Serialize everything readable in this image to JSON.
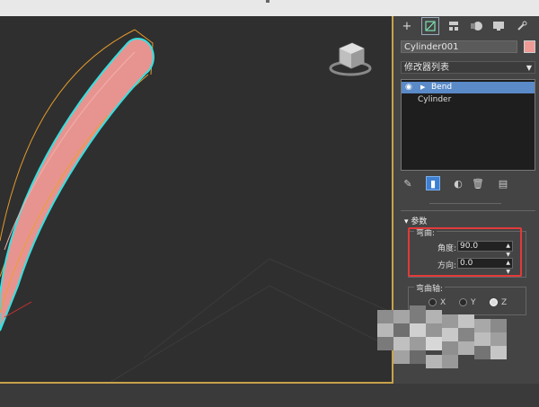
{
  "command_panel": {
    "object_name": "Cylinder001",
    "modifier_list_label": "修改器列表",
    "stack": [
      {
        "label": "Bend",
        "selected": true
      },
      {
        "label": "Cylinder",
        "selected": false
      }
    ]
  },
  "parameters": {
    "title": "参数",
    "bend_group_label": "弯曲:",
    "angle_label": "角度:",
    "angle_value": "90.0",
    "direction_label": "方向:",
    "direction_value": "0.0",
    "axis_group_label": "弯曲轴:",
    "axes": [
      {
        "label": "X",
        "selected": false
      },
      {
        "label": "Y",
        "selected": false
      },
      {
        "label": "Z",
        "selected": true
      }
    ]
  },
  "colors": {
    "object_color": "#f09a96",
    "selection_highlight": "#5a8ac8",
    "annotation_box": "#e23a3a",
    "viewport_border": "#c8a24a"
  }
}
